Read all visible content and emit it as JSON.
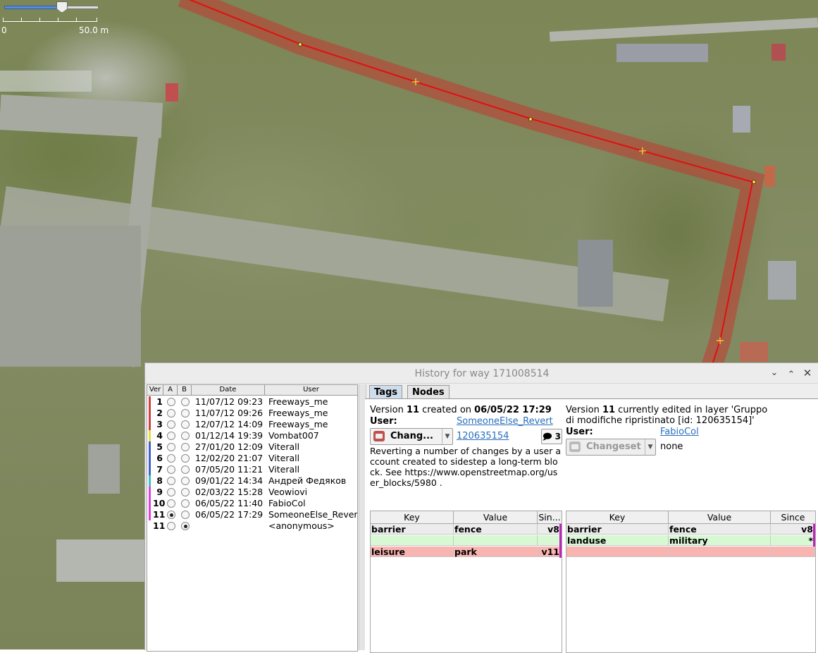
{
  "map": {
    "scale_zero": "0",
    "scale_label": "50.0 m"
  },
  "dialog": {
    "title": "History for way 171008514",
    "buttons": [
      "chevron-down",
      "chevron-up",
      "close"
    ]
  },
  "list": {
    "headers": {
      "ver": "Ver",
      "a": "A",
      "b": "B",
      "date": "Date",
      "user": "User"
    },
    "rows": [
      {
        "ver": "1",
        "date": "11/07/12 09:23",
        "user": "Freeways_me",
        "color": "#d04040",
        "a": false,
        "b": false
      },
      {
        "ver": "2",
        "date": "11/07/12 09:26",
        "user": "Freeways_me",
        "color": "#d04040",
        "a": false,
        "b": false
      },
      {
        "ver": "3",
        "date": "12/07/12 14:09",
        "user": "Freeways_me",
        "color": "#d04040",
        "a": false,
        "b": false
      },
      {
        "ver": "4",
        "date": "01/12/14 19:39",
        "user": "Vombat007",
        "color": "#e0e040",
        "a": false,
        "b": false
      },
      {
        "ver": "5",
        "date": "27/01/20 12:09",
        "user": "Viterall",
        "color": "#4060d0",
        "a": false,
        "b": false
      },
      {
        "ver": "6",
        "date": "12/02/20 21:07",
        "user": "Viterall",
        "color": "#4060d0",
        "a": false,
        "b": false
      },
      {
        "ver": "7",
        "date": "07/05/20 11:21",
        "user": "Viterall",
        "color": "#4060d0",
        "a": false,
        "b": false
      },
      {
        "ver": "8",
        "date": "09/01/22 14:34",
        "user": "Андрей Федяков",
        "color": "#40c0c0",
        "a": false,
        "b": false
      },
      {
        "ver": "9",
        "date": "02/03/22 15:28",
        "user": "Veowiovi",
        "color": "#e040e0",
        "a": false,
        "b": false
      },
      {
        "ver": "10",
        "date": "06/05/22 11:40",
        "user": "FabioCol",
        "color": "#e040e0",
        "a": false,
        "b": false
      },
      {
        "ver": "11",
        "date": "06/05/22 17:29",
        "user": "SomeoneElse_Revert",
        "color": "#e040e0",
        "a": true,
        "b": false
      },
      {
        "ver": "11",
        "date": "",
        "user": "<anonymous>",
        "color": "",
        "a": false,
        "b": true
      }
    ]
  },
  "tabs": [
    {
      "label": "Tags",
      "active": true
    },
    {
      "label": "Nodes",
      "active": false
    }
  ],
  "left": {
    "version_prefix": "Version ",
    "version": "11",
    "created_on": " created on ",
    "date": "06/05/22 17:29",
    "user_label": "User:",
    "user": "SomeoneElse_Revert",
    "changeset_label": "Chang...",
    "changeset_id": "120635154",
    "comments": "3",
    "comment": "Reverting a number of changes by a user account created to sidestep a long-term block.  See https://www.openstreetmap.org/user_blocks/5980 .",
    "table": {
      "headers": {
        "key": "Key",
        "value": "Value",
        "since": "Sin..."
      },
      "rows": [
        {
          "key": "barrier",
          "value": "fence",
          "since": "v8",
          "style": "grey"
        },
        {
          "key": "",
          "value": "",
          "since": "",
          "style": "green"
        },
        {
          "key": "leisure",
          "value": "park",
          "since": "v11",
          "style": "red"
        }
      ]
    }
  },
  "right": {
    "version_prefix": "Version ",
    "version": "11",
    "edited_text": " currently edited in layer 'Gruppo di modifiche ripristinato [id: 120635154]'",
    "user_label": "User:",
    "user": "FabioCol",
    "changeset_label": "Changeset",
    "changeset_value": "none",
    "table": {
      "headers": {
        "key": "Key",
        "value": "Value",
        "since": "Since"
      },
      "rows": [
        {
          "key": "barrier",
          "value": "fence",
          "since": "v8",
          "style": "grey"
        },
        {
          "key": "landuse",
          "value": "military",
          "since": "*",
          "style": "green"
        },
        {
          "key": "",
          "value": "",
          "since": "",
          "style": "red"
        }
      ]
    }
  }
}
